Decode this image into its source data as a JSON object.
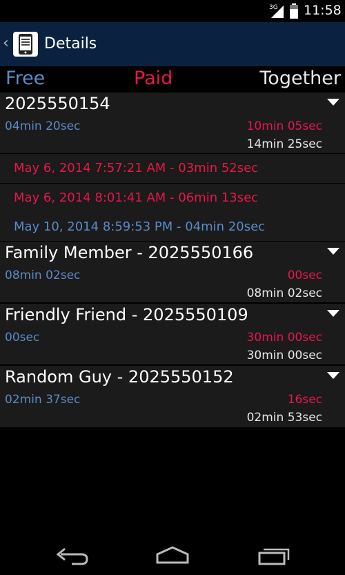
{
  "status": {
    "network": "3G",
    "time": "11:58"
  },
  "header": {
    "title": "Details"
  },
  "tabs": {
    "free": "Free",
    "paid": "Paid",
    "together": "Together"
  },
  "groups": [
    {
      "title": "2025550154",
      "free": "04min 20sec",
      "paid": "10min 05sec",
      "total": "14min 25sec",
      "calls": [
        {
          "text": "May 6, 2014 7:57:21 AM - 03min 52sec",
          "kind": "paid"
        },
        {
          "text": "May 6, 2014 8:01:41 AM - 06min 13sec",
          "kind": "paid"
        },
        {
          "text": "May 10, 2014 8:59:53 PM - 04min 20sec",
          "kind": "free"
        }
      ]
    },
    {
      "title": "Family Member - 2025550166",
      "free": "08min 02sec",
      "paid": "00sec",
      "total": "08min 02sec"
    },
    {
      "title": "Friendly Friend - 2025550109",
      "free": "00sec",
      "paid": "30min 00sec",
      "total": "30min 00sec"
    },
    {
      "title": "Random Guy - 2025550152",
      "free": "02min 37sec",
      "paid": "16sec",
      "total": "02min 53sec"
    }
  ],
  "colors": {
    "free": "#5b8bc9",
    "paid": "#e8174b",
    "together": "#e8e8e8",
    "actionbar": "#0a2240"
  }
}
